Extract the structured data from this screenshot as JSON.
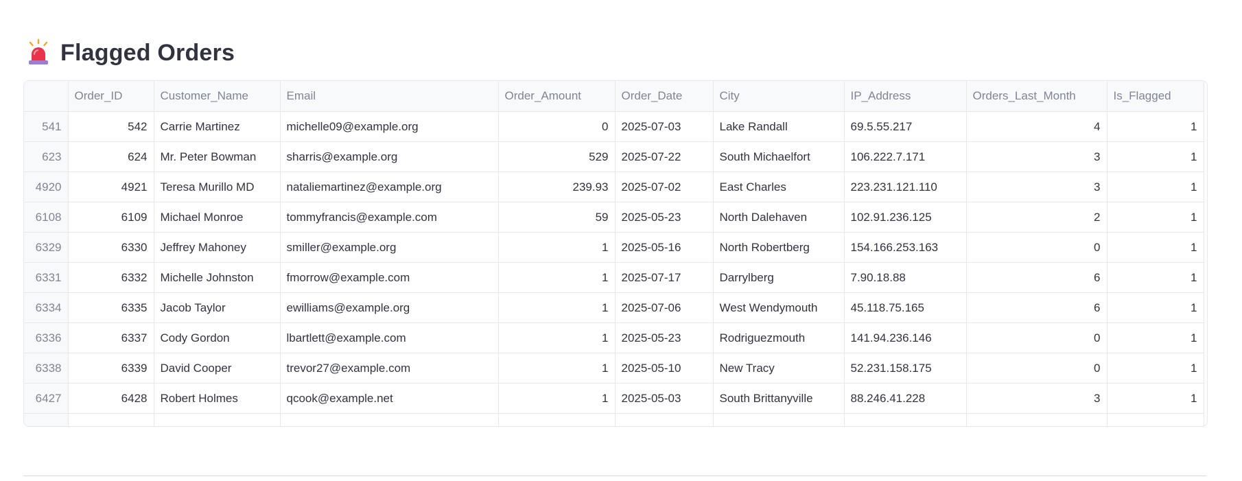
{
  "header": {
    "icon": "siren-icon",
    "title": "Flagged Orders"
  },
  "colors": {
    "text": "#31333f",
    "muted": "#808495",
    "header_bg": "#f8f9fb",
    "border": "#e6e8ee",
    "siren_red": "#e8334a",
    "siren_base": "#9b7fd4",
    "siren_rays": "#f5a623"
  },
  "table": {
    "columns": [
      "",
      "Order_ID",
      "Customer_Name",
      "Email",
      "Order_Amount",
      "Order_Date",
      "City",
      "IP_Address",
      "Orders_Last_Month",
      "Is_Flagged"
    ],
    "rows": [
      [
        "541",
        "542",
        "Carrie Martinez",
        "michelle09@example.org",
        "0",
        "2025-07-03",
        "Lake Randall",
        "69.5.55.217",
        "4",
        "1"
      ],
      [
        "623",
        "624",
        "Mr. Peter Bowman",
        "sharris@example.org",
        "529",
        "2025-07-22",
        "South Michaelfort",
        "106.222.7.171",
        "3",
        "1"
      ],
      [
        "4920",
        "4921",
        "Teresa Murillo MD",
        "nataliemartinez@example.org",
        "239.93",
        "2025-07-02",
        "East Charles",
        "223.231.121.110",
        "3",
        "1"
      ],
      [
        "6108",
        "6109",
        "Michael Monroe",
        "tommyfrancis@example.com",
        "59",
        "2025-05-23",
        "North Dalehaven",
        "102.91.236.125",
        "2",
        "1"
      ],
      [
        "6329",
        "6330",
        "Jeffrey Mahoney",
        "smiller@example.org",
        "1",
        "2025-05-16",
        "North Robertberg",
        "154.166.253.163",
        "0",
        "1"
      ],
      [
        "6331",
        "6332",
        "Michelle Johnston",
        "fmorrow@example.com",
        "1",
        "2025-07-17",
        "Darrylberg",
        "7.90.18.88",
        "6",
        "1"
      ],
      [
        "6334",
        "6335",
        "Jacob Taylor",
        "ewilliams@example.org",
        "1",
        "2025-07-06",
        "West Wendymouth",
        "45.118.75.165",
        "6",
        "1"
      ],
      [
        "6336",
        "6337",
        "Cody Gordon",
        "lbartlett@example.com",
        "1",
        "2025-05-23",
        "Rodriguezmouth",
        "141.94.236.146",
        "0",
        "1"
      ],
      [
        "6338",
        "6339",
        "David Cooper",
        "trevor27@example.com",
        "1",
        "2025-05-10",
        "New Tracy",
        "52.231.158.175",
        "0",
        "1"
      ],
      [
        "6427",
        "6428",
        "Robert Holmes",
        "qcook@example.net",
        "1",
        "2025-05-03",
        "South Brittanyville",
        "88.246.41.228",
        "3",
        "1"
      ]
    ]
  }
}
